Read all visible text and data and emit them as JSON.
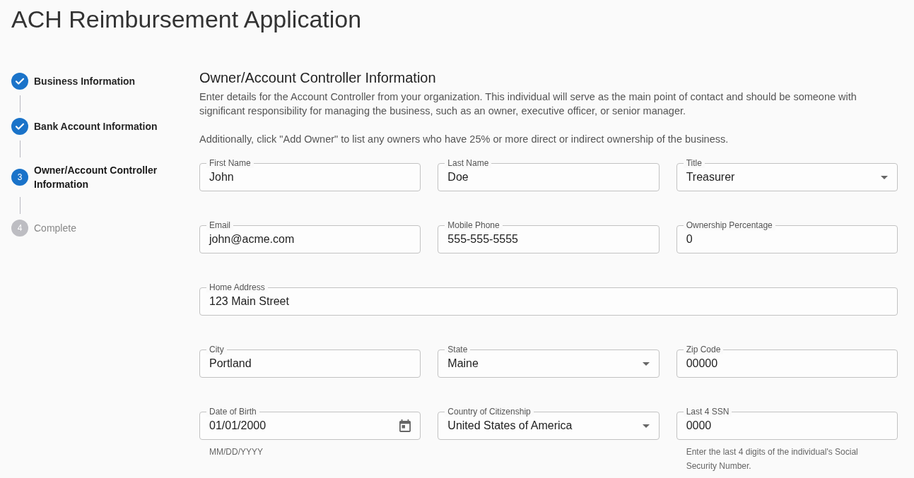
{
  "page": {
    "title": "ACH Reimbursement Application"
  },
  "steps": [
    {
      "label": "Business Information",
      "completed": true,
      "active": false
    },
    {
      "label": "Bank Account Information",
      "completed": true,
      "active": false
    },
    {
      "number": "3",
      "label": "Owner/Account Controller Information",
      "completed": false,
      "active": true
    },
    {
      "number": "4",
      "label": "Complete",
      "completed": false,
      "active": false
    }
  ],
  "section": {
    "title": "Owner/Account Controller Information",
    "paragraphs": [
      "Enter details for the Account Controller from your organization. This individual will serve as the main point of contact and should be someone with significant responsibility for managing the business, such as an owner, executive officer, or senior manager.",
      "Additionally, click \"Add Owner\" to list any owners who have 25% or more direct or indirect ownership of the business."
    ]
  },
  "form_rows": [
    {
      "fields": [
        {
          "kind": "text",
          "label": "First Name",
          "value": "John"
        },
        {
          "kind": "text",
          "label": "Last Name",
          "value": "Doe"
        },
        {
          "kind": "select",
          "label": "Title",
          "value": "Treasurer"
        }
      ]
    },
    {
      "fields": [
        {
          "kind": "text",
          "label": "Email",
          "value": "john@acme.com"
        },
        {
          "kind": "text",
          "label": "Mobile Phone",
          "value": "555-555-5555"
        },
        {
          "kind": "text",
          "label": "Ownership Percentage",
          "value": "0"
        }
      ]
    },
    {
      "fields": [
        {
          "kind": "text",
          "label": "Home Address",
          "value": "123 Main Street"
        }
      ]
    },
    {
      "fields": [
        {
          "kind": "text",
          "label": "City",
          "value": "Portland"
        },
        {
          "kind": "select",
          "label": "State",
          "value": "Maine"
        },
        {
          "kind": "text",
          "label": "Zip Code",
          "value": "00000"
        }
      ]
    },
    {
      "fields": [
        {
          "kind": "date",
          "label": "Date of Birth",
          "value": "01/01/2000",
          "helper": "MM/DD/YYYY"
        },
        {
          "kind": "select",
          "label": "Country of Citizenship",
          "value": "United States of America"
        },
        {
          "kind": "text",
          "label": "Last 4 SSN",
          "value": "0000",
          "helper": "Enter the last 4 digits of the individual's Social Security Number."
        }
      ]
    }
  ]
}
